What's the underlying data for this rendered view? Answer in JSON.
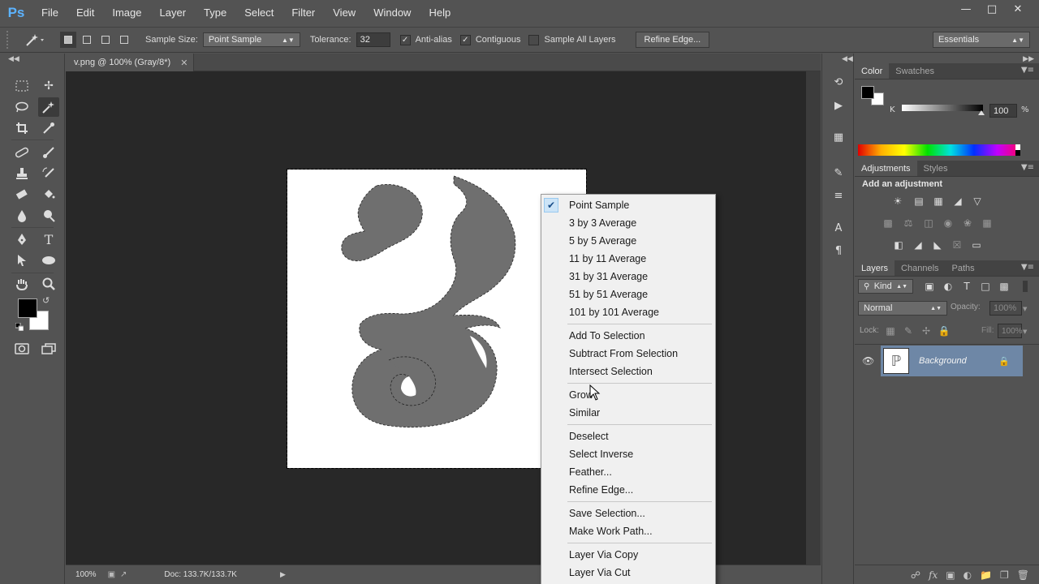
{
  "app": {
    "logo": "Ps",
    "menus": [
      "File",
      "Edit",
      "Image",
      "Layer",
      "Type",
      "Select",
      "Filter",
      "View",
      "Window",
      "Help"
    ],
    "window_controls": [
      "minimize-icon",
      "maximize-icon",
      "close-icon"
    ]
  },
  "options_bar": {
    "sample_size_label": "Sample Size:",
    "sample_size_value": "Point Sample",
    "tolerance_label": "Tolerance:",
    "tolerance_value": "32",
    "anti_alias_label": "Anti-alias",
    "anti_alias_checked": true,
    "contiguous_label": "Contiguous",
    "contiguous_checked": true,
    "sample_all_layers_label": "Sample All Layers",
    "sample_all_layers_checked": false,
    "refine_edge_label": "Refine Edge...",
    "workspace_value": "Essentials"
  },
  "document": {
    "tab_title": "v.png @ 100% (Gray/8*)",
    "zoom": "100%",
    "doc_size": "Doc: 133.7K/133.7K"
  },
  "context_menu": {
    "items": [
      {
        "label": "Point Sample",
        "checked": true
      },
      {
        "label": "3 by 3 Average"
      },
      {
        "label": "5 by 5 Average"
      },
      {
        "label": "11 by 11 Average"
      },
      {
        "label": "31 by 31 Average"
      },
      {
        "label": "51 by 51 Average"
      },
      {
        "label": "101 by 101 Average"
      },
      {
        "label": "Add To Selection"
      },
      {
        "label": "Subtract From Selection"
      },
      {
        "label": "Intersect Selection"
      },
      {
        "label": "Grow"
      },
      {
        "label": "Similar"
      },
      {
        "label": "Deselect"
      },
      {
        "label": "Select Inverse"
      },
      {
        "label": "Feather..."
      },
      {
        "label": "Refine Edge..."
      },
      {
        "label": "Save Selection..."
      },
      {
        "label": "Make Work Path..."
      },
      {
        "label": "Layer Via Copy"
      },
      {
        "label": "Layer Via Cut"
      }
    ]
  },
  "color_panel": {
    "tabs": [
      "Color",
      "Swatches"
    ],
    "channel_label": "K",
    "channel_value": "100",
    "unit": "%"
  },
  "adjustments_panel": {
    "tabs": [
      "Adjustments",
      "Styles"
    ],
    "heading": "Add an adjustment"
  },
  "layers_panel": {
    "tabs": [
      "Layers",
      "Channels",
      "Paths"
    ],
    "filter_kind": "Kind",
    "blend_mode": "Normal",
    "opacity_label": "Opacity:",
    "opacity_value": "100%",
    "lock_label": "Lock:",
    "fill_label": "Fill:",
    "fill_value": "100%",
    "layers": [
      {
        "name": "Background",
        "locked": true,
        "visible": true
      }
    ]
  },
  "colors": {
    "accent": "#5cb3ff",
    "selected_layer": "#6e87a6",
    "menu_background": "#f0f0f0"
  }
}
